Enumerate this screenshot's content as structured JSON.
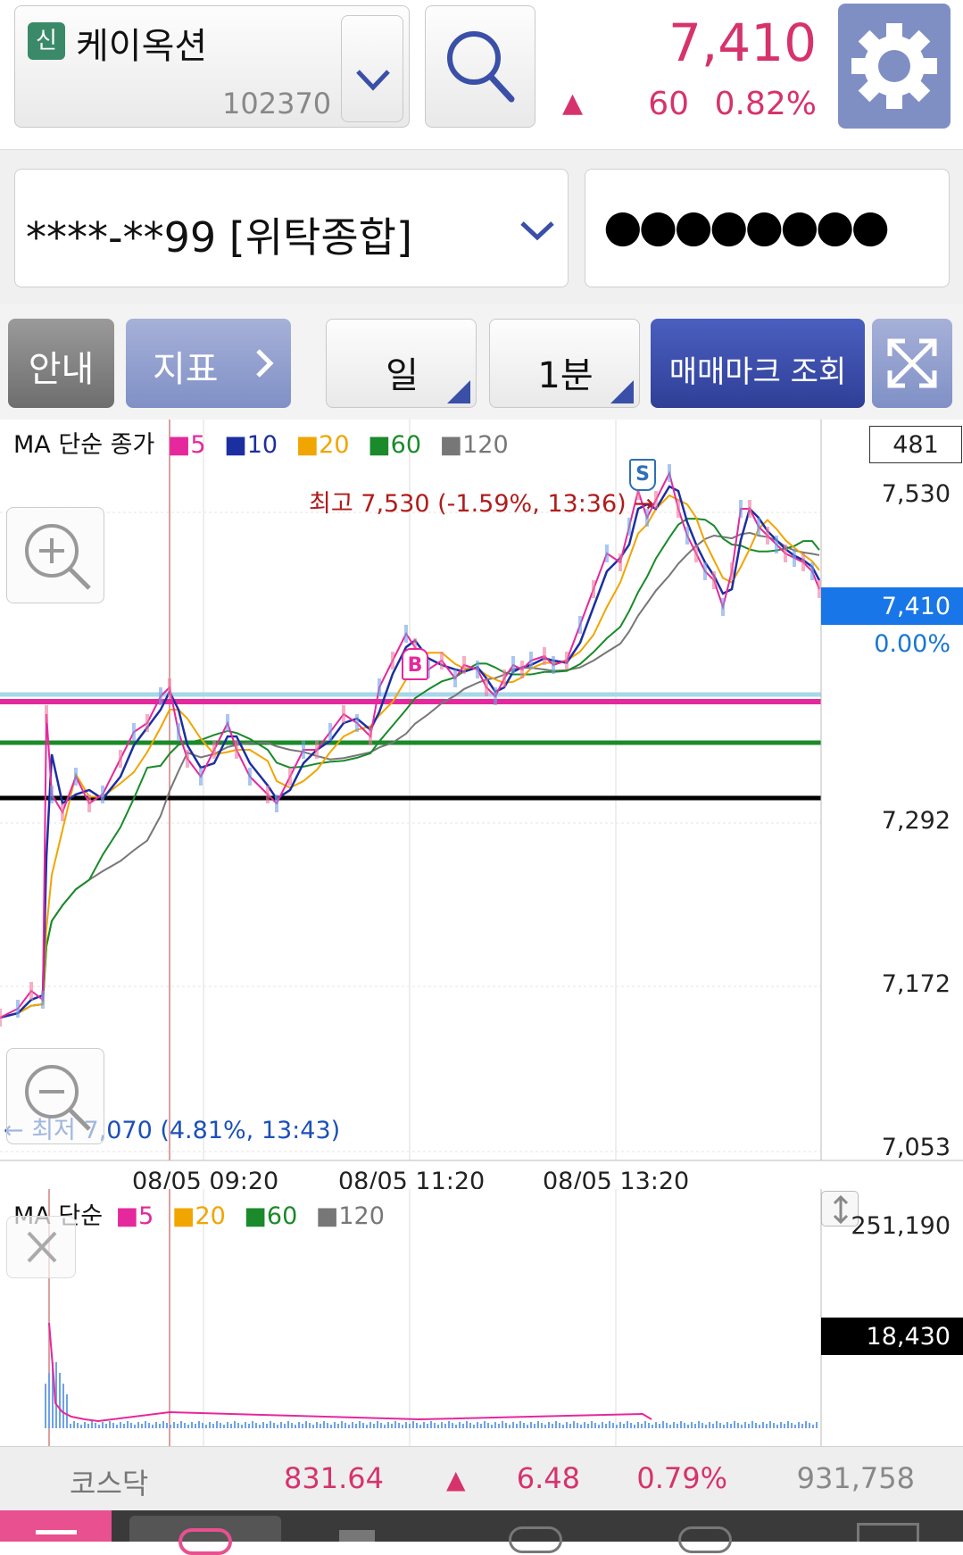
{
  "stock": {
    "badge": "신",
    "name": "케이옥션",
    "code": "102370",
    "price": "7,410",
    "change": "60",
    "change_pct": "0.82%",
    "up_arrow": "▲"
  },
  "account": {
    "number": "****-**99 [위탁종합]",
    "password_mask": "●●●●●●●●"
  },
  "toolbar": {
    "guide_label": "안내",
    "indicator_label": "지표",
    "period_label": "일",
    "interval_label": "1분",
    "trade_mark_label": "매매마크 조회"
  },
  "main_chart": {
    "legend_title": "MA 단순 종가",
    "legend": [
      {
        "label": "5",
        "color": "#e5289c"
      },
      {
        "label": "10",
        "color": "#1c2fa0"
      },
      {
        "label": "20",
        "color": "#f0a500"
      },
      {
        "label": "60",
        "color": "#1a8a2a"
      },
      {
        "label": "120",
        "color": "#777777"
      }
    ],
    "countdown": "481",
    "y_labels": [
      "7,530",
      "7,292",
      "7,172",
      "7,053"
    ],
    "current_price": "7,410",
    "current_pct": "0.00%",
    "x_labels": [
      "08/05 09:20",
      "08/05 11:20",
      "08/05 13:20"
    ],
    "high_annotation": "최고 7,530 (-1.59%, 13:36) →",
    "low_annotation": "← 최저 7,070 (4.81%, 13:43)",
    "buy_mark": "B",
    "sell_mark": "S"
  },
  "volume_chart": {
    "legend_title": "MA 단순",
    "legend": [
      {
        "label": "5",
        "color": "#e5289c"
      },
      {
        "label": "20",
        "color": "#f0a500"
      },
      {
        "label": "60",
        "color": "#1a8a2a"
      },
      {
        "label": "120",
        "color": "#777777"
      }
    ],
    "y_max": "251,190",
    "current_volume": "18,430"
  },
  "index_bar": {
    "name": "코스닥",
    "value": "831.64",
    "arrow": "▲",
    "change": "6.48",
    "change_pct": "0.79%",
    "volume": "931,758"
  },
  "colors": {
    "up": "#d6336c",
    "accent_blue": "#3a4fa8",
    "gear_bg": "#7f8fc4"
  }
}
